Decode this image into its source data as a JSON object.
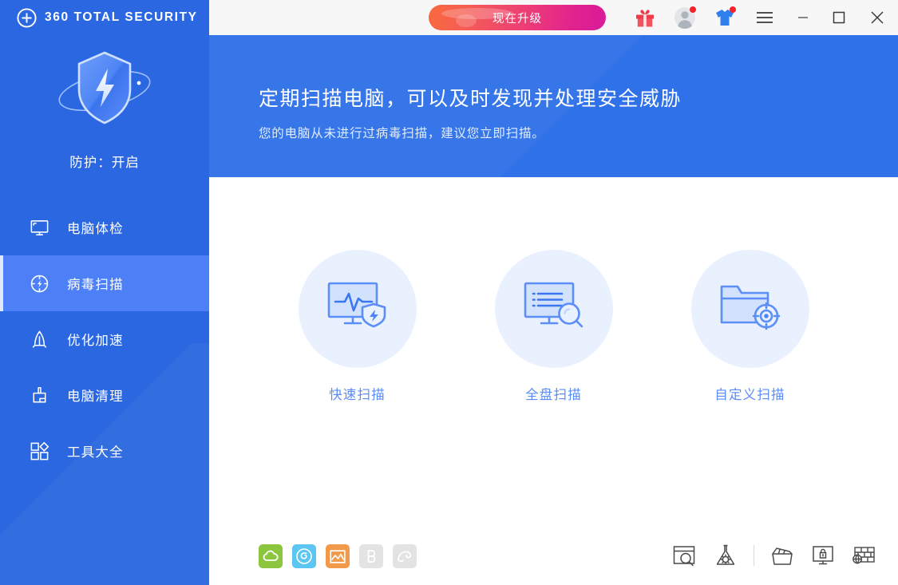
{
  "brand": {
    "name": "360 TOTAL SECURITY",
    "logo_icon": "plus-circle-icon"
  },
  "sidebar": {
    "shield_icon": "shield-orbit-icon",
    "protection_status": "防护：开启",
    "items": [
      {
        "label": "电脑体检",
        "icon": "monitor-icon",
        "active": false
      },
      {
        "label": "病毒扫描",
        "icon": "virus-scan-icon",
        "active": true
      },
      {
        "label": "优化加速",
        "icon": "rocket-icon",
        "active": false
      },
      {
        "label": "电脑清理",
        "icon": "broom-icon",
        "active": false
      },
      {
        "label": "工具大全",
        "icon": "toolbox-grid-icon",
        "active": false
      }
    ]
  },
  "titlebar": {
    "upgrade_label": "现在升级",
    "icons": [
      {
        "name": "gift-icon",
        "badge": false
      },
      {
        "name": "user-avatar-icon",
        "badge": true
      },
      {
        "name": "tshirt-skin-icon",
        "badge": true
      },
      {
        "name": "hamburger-menu-icon",
        "badge": false
      }
    ],
    "window_controls": [
      {
        "name": "minimize-button",
        "glyph": "—"
      },
      {
        "name": "maximize-button",
        "glyph": "□"
      },
      {
        "name": "close-button",
        "glyph": "✕"
      }
    ]
  },
  "banner": {
    "title": "定期扫描电脑，可以及时发现并处理安全威胁",
    "subtitle": "您的电脑从未进行过病毒扫描，建议您立即扫描。"
  },
  "scan_options": [
    {
      "label": "快速扫描",
      "icon": "monitor-pulse-shield-icon"
    },
    {
      "label": "全盘扫描",
      "icon": "monitor-list-magnifier-icon"
    },
    {
      "label": "自定义扫描",
      "icon": "folder-target-icon"
    }
  ],
  "vendor_engines": [
    {
      "name": "cloud-engine-icon",
      "color": "#8cc63e",
      "enabled": true
    },
    {
      "name": "qvm-engine-icon",
      "color": "#5bc6f2",
      "enabled": true
    },
    {
      "name": "avira-engine-icon",
      "color": "#f2994a",
      "enabled": true
    },
    {
      "name": "bitdefender-engine-icon",
      "color": "#e3e3e3",
      "enabled": false
    },
    {
      "name": "avira-umbrella-engine-icon",
      "color": "#e3e3e3",
      "enabled": false
    }
  ],
  "tools": [
    {
      "name": "scan-window-icon"
    },
    {
      "name": "virus-flask-icon"
    },
    {
      "name": "quarantine-box-icon"
    },
    {
      "name": "screen-lock-icon"
    },
    {
      "name": "firewall-globe-icon"
    }
  ],
  "colors": {
    "sidebar_blue": "#2a67e0",
    "sidebar_active_blue": "#4d80f7",
    "banner_blue": "#2f71e8",
    "accent_link": "#5a8cf8",
    "circle_bg": "#eaf1fe",
    "titlebar_bg": "#f7f7f7",
    "badge_red": "#f5222d"
  }
}
